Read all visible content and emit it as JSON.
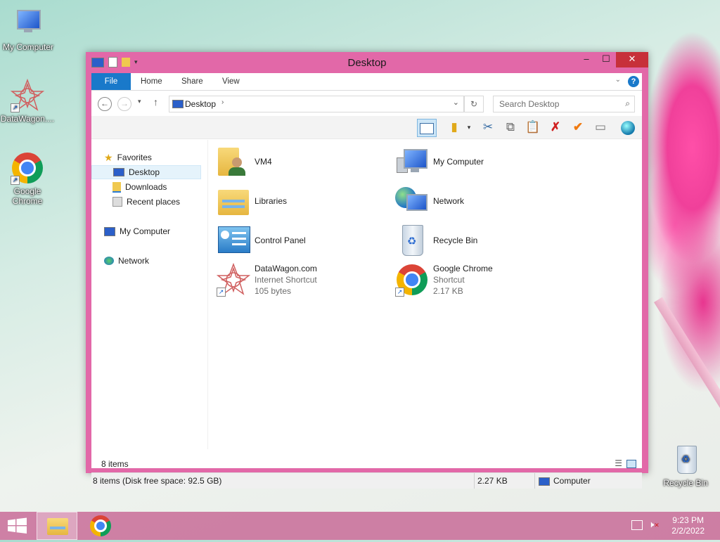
{
  "desktop": {
    "icons": [
      {
        "label": "My Computer",
        "icon": "computer-icon"
      },
      {
        "label": "DataWagon....",
        "icon": "datawagon-icon"
      },
      {
        "label": "Google Chrome",
        "icon": "chrome-icon"
      },
      {
        "label": "Recycle Bin",
        "icon": "recycle-bin-icon"
      }
    ]
  },
  "window": {
    "title": "Desktop",
    "tabs": [
      {
        "label": "File"
      },
      {
        "label": "Home"
      },
      {
        "label": "Share"
      },
      {
        "label": "View"
      }
    ],
    "address": {
      "location": "Desktop",
      "search_placeholder": "Search Desktop"
    },
    "nav": {
      "favorites": "Favorites",
      "desktop": "Desktop",
      "downloads": "Downloads",
      "recent": "Recent places",
      "computer": "My Computer",
      "network": "Network"
    },
    "items": [
      {
        "name": "VM4",
        "icon": "user-folder-icon"
      },
      {
        "name": "My Computer",
        "icon": "computer-icon"
      },
      {
        "name": "Libraries",
        "icon": "libraries-icon"
      },
      {
        "name": "Network",
        "icon": "network-icon"
      },
      {
        "name": "Control Panel",
        "icon": "control-panel-icon"
      },
      {
        "name": "Recycle Bin",
        "icon": "recycle-bin-icon"
      },
      {
        "name": "DataWagon.com",
        "type": "Internet Shortcut",
        "size": "105 bytes",
        "icon": "datawagon-icon"
      },
      {
        "name": "Google Chrome",
        "type": "Shortcut",
        "size": "2.17 KB",
        "icon": "chrome-icon"
      }
    ],
    "item_count": "8 items",
    "status": {
      "left": "8 items (Disk free space: 92.5 GB)",
      "size": "2.27 KB",
      "location": "Computer"
    }
  },
  "taskbar": {
    "time": "9:23 PM",
    "date": "2/2/2022"
  },
  "colors": {
    "window_frame": "#e268a8",
    "file_tab": "#1979ca",
    "close_button": "#c7303a"
  }
}
